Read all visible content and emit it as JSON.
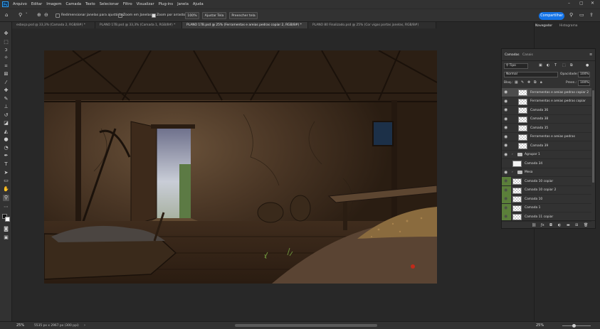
{
  "menubar": {
    "logo": "Ps",
    "items": [
      "Arquivo",
      "Editar",
      "Imagem",
      "Camada",
      "Texto",
      "Selecionar",
      "Filtro",
      "Visualizar",
      "Plug-ins",
      "Janela",
      "Ajuda"
    ]
  },
  "options": {
    "resize_windows_label": "Redimensionar janelas para ajustá-las",
    "zoom_all_label": "Zoom em Janelas",
    "scrubby_zoom_label": "Zoom por arrasto",
    "zoom_100": "100%",
    "fit_screen": "Ajustar Tela",
    "fill_screen": "Preencher tela",
    "share": "Compartilhar"
  },
  "tabs": [
    {
      "label": "esboço.psd @ 33,3% (Camada 2, RGB/8#) *",
      "active": false
    },
    {
      "label": "PLANO 17B.psd @ 33,3% (Camada 1, RGB/8#) *",
      "active": false
    },
    {
      "label": "PLANO 17B.psd @ 25% (Ferramentas e areias pedras copiar 2, RGB/8#) *",
      "active": true
    },
    {
      "label": "PLANO 80 Finalizado.psd @ 25% (Cor vigas portas janelas, RGB/8#)",
      "active": false
    }
  ],
  "right_tabs": {
    "navigator": "Navegador",
    "histogram": "Histograma"
  },
  "layers_panel": {
    "tabs": [
      "Camadas",
      "Canais"
    ],
    "filter_value": "Tipo",
    "blend_mode": "Normal",
    "opacity_label": "Opacidade:",
    "opacity_value": "100%",
    "lock_label": "Bloq.:",
    "fill_label": "Preen.:",
    "fill_value": "100%",
    "layers": [
      {
        "name": "Ferramentas e areias pedras copiar 2",
        "kind": "layer",
        "visible": true,
        "selected": true,
        "green": false
      },
      {
        "name": "Ferramentas e areias pedras copiar",
        "kind": "layer",
        "visible": true,
        "selected": false,
        "green": false
      },
      {
        "name": "Camada 36",
        "kind": "layer",
        "visible": true,
        "selected": false,
        "green": false
      },
      {
        "name": "Camada 38",
        "kind": "layer",
        "visible": true,
        "selected": false,
        "green": false
      },
      {
        "name": "Camada 35",
        "kind": "layer",
        "visible": true,
        "selected": false,
        "green": false
      },
      {
        "name": "Ferramentas e areias pedras",
        "kind": "layer",
        "visible": true,
        "selected": false,
        "green": false
      },
      {
        "name": "Camada 39",
        "kind": "layer",
        "visible": true,
        "selected": false,
        "green": false
      },
      {
        "name": "Agrupar 1",
        "kind": "group",
        "visible": true,
        "selected": false,
        "green": false
      },
      {
        "name": "Camada 34",
        "kind": "solid",
        "visible": false,
        "selected": false,
        "green": false
      },
      {
        "name": "Mesa",
        "kind": "group",
        "visible": true,
        "selected": false,
        "green": false
      },
      {
        "name": "Camada 10 copiar",
        "kind": "layer",
        "visible": true,
        "selected": false,
        "green": true
      },
      {
        "name": "Camada 10 copiar 2",
        "kind": "layer",
        "visible": true,
        "selected": false,
        "green": true
      },
      {
        "name": "Camada 10",
        "kind": "layer",
        "visible": true,
        "selected": false,
        "green": true
      },
      {
        "name": "Camada 1",
        "kind": "layer",
        "visible": true,
        "selected": false,
        "green": true
      },
      {
        "name": "Camada 11 copiar",
        "kind": "layer",
        "visible": true,
        "selected": false,
        "green": true
      }
    ]
  },
  "status": {
    "zoom": "25%",
    "doc_size": "5535 px x 2967 px (300 ppi)",
    "nav_zoom": "25%"
  }
}
